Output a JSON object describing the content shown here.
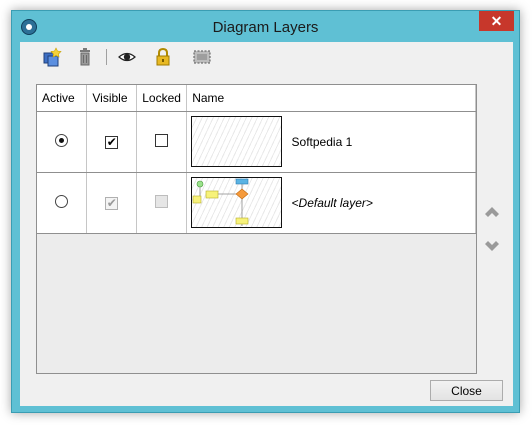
{
  "window": {
    "title": "Diagram Layers",
    "close_glyph": "✕",
    "app_icon": "diagram-app-icon"
  },
  "toolbar": {
    "buttons": [
      {
        "name": "new-layer-icon"
      },
      {
        "name": "delete-layer-icon"
      },
      {
        "name": "visibility-eye-icon"
      },
      {
        "name": "lock-icon"
      },
      {
        "name": "select-layer-icon"
      }
    ]
  },
  "table": {
    "headers": [
      "Active",
      "Visible",
      "Locked",
      "Name"
    ],
    "rows": [
      {
        "active": true,
        "visible": true,
        "visible_enabled": true,
        "locked": false,
        "locked_enabled": true,
        "name": "Softpedia 1"
      },
      {
        "active": false,
        "visible": true,
        "visible_enabled": false,
        "locked": false,
        "locked_enabled": false,
        "name": "<Default layer>"
      }
    ]
  },
  "side_buttons": {
    "up": "move-up-icon",
    "down": "move-down-icon"
  },
  "footer": {
    "close_label": "Close"
  },
  "colors": {
    "titlebar": "#5fc0d4",
    "close_red": "#c7372b",
    "client_bg": "#f0f0f0"
  }
}
